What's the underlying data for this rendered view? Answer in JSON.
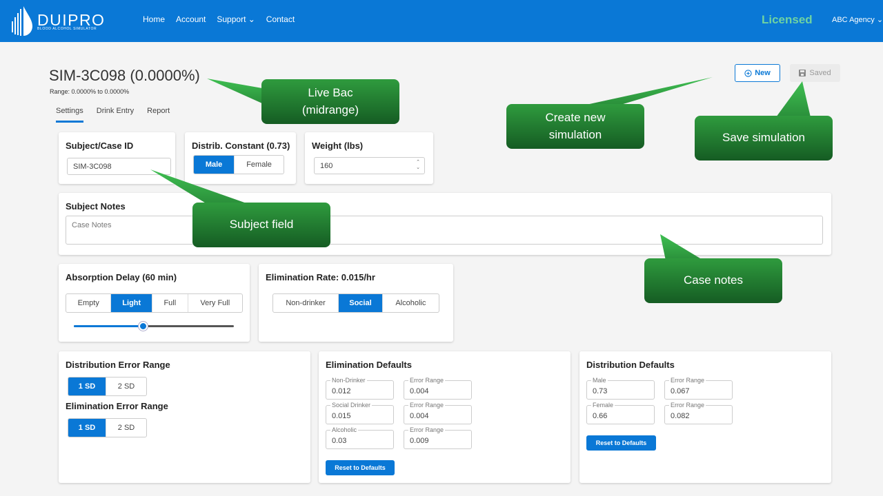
{
  "navbar": {
    "logo_text": "DUIPRO",
    "logo_subtitle": "BLOOD ALCOHOL SIMULATOR",
    "links": [
      {
        "label": "Home"
      },
      {
        "label": "Account"
      },
      {
        "label": "Support ⌄"
      },
      {
        "label": "Contact"
      }
    ],
    "license_status": "Licensed",
    "agency_menu": "ABC Agency ⌄"
  },
  "header": {
    "title": "SIM-3C098 (0.0000%)",
    "range": "Range: 0.0000% to 0.0000%",
    "tabs": [
      {
        "label": "Settings",
        "active": true
      },
      {
        "label": "Drink Entry",
        "active": false
      },
      {
        "label": "Report",
        "active": false
      }
    ],
    "new_button": {
      "icon": "plus-circle-icon",
      "label": "New"
    },
    "saved_button": {
      "icon": "floppy-disk-icon",
      "label": "Saved"
    }
  },
  "subject": {
    "title": "Subject/Case ID",
    "value": "SIM-3C098"
  },
  "distrib_constant": {
    "title": "Distrib. Constant (0.73)",
    "options": [
      "Male",
      "Female"
    ],
    "selected": "Male"
  },
  "weight": {
    "title": "Weight (lbs)",
    "value": "160"
  },
  "notes": {
    "title": "Subject Notes",
    "placeholder": "Case Notes"
  },
  "absorption": {
    "title": "Absorption Delay (60 min)",
    "options": [
      "Empty",
      "Light",
      "Full",
      "Very Full"
    ],
    "selected": "Light",
    "slider_fraction": 0.43
  },
  "elimination_rate": {
    "title": "Elimination Rate: 0.015/hr",
    "options": [
      "Non-drinker",
      "Social",
      "Alcoholic"
    ],
    "selected": "Social"
  },
  "error_ranges": {
    "distribution_title": "Distribution Error Range",
    "distribution_options": [
      "1 SD",
      "2 SD"
    ],
    "distribution_selected": "1 SD",
    "elimination_title": "Elimination Error Range",
    "elimination_options": [
      "1 SD",
      "2 SD"
    ],
    "elimination_selected": "1 SD"
  },
  "elimination_defaults": {
    "title": "Elimination Defaults",
    "rows": [
      {
        "label": "Non-Drinker",
        "value": "0.012",
        "error_label": "Error Range",
        "error_value": "0.004"
      },
      {
        "label": "Social Drinker",
        "value": "0.015",
        "error_label": "Error Range",
        "error_value": "0.004"
      },
      {
        "label": "Alcoholic",
        "value": "0.03",
        "error_label": "Error Range",
        "error_value": "0.009"
      }
    ],
    "reset_label": "Reset to Defaults"
  },
  "distribution_defaults": {
    "title": "Distribution Defaults",
    "rows": [
      {
        "label": "Male",
        "value": "0.73",
        "error_label": "Error Range",
        "error_value": "0.067"
      },
      {
        "label": "Female",
        "value": "0.66",
        "error_label": "Error Range",
        "error_value": "0.082"
      }
    ],
    "reset_label": "Reset to Defaults"
  },
  "callouts": {
    "live_bac": "Live Bac\n(midrange)",
    "create_new": "Create new\nsimulation",
    "save": "Save simulation",
    "subject_field": "Subject field",
    "case_notes": "Case notes"
  },
  "colors": {
    "primary": "#0a78d6",
    "licensed": "#6fd3a2",
    "callout_top": "#2f9b3e",
    "callout_bottom": "#155c23"
  }
}
